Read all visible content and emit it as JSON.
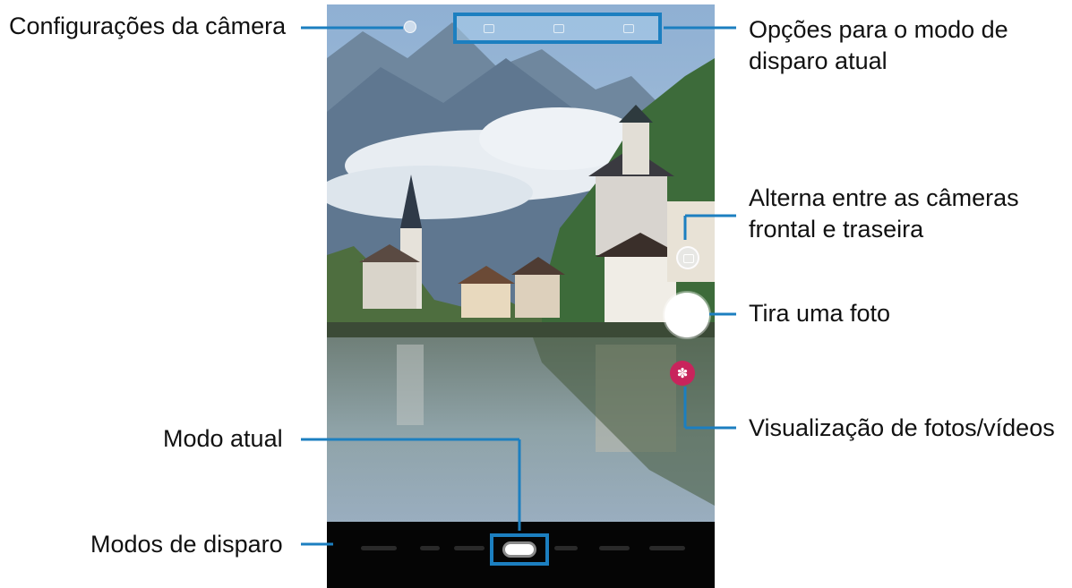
{
  "callouts": {
    "camera_settings": "Configurações da câmera",
    "shooting_options_line1": "Opções para o modo de",
    "shooting_options_line2": "disparo atual",
    "switch_cameras_line1": "Alterna entre as câmeras",
    "switch_cameras_line2": "frontal e traseira",
    "take_photo": "Tira uma foto",
    "preview": "Visualização de fotos/vídeos",
    "current_mode": "Modo atual",
    "shooting_modes": "Modos de disparo"
  },
  "icons": {
    "settings": "gear-icon",
    "top_options": [
      "flash-icon",
      "timer-icon",
      "ratio-icon"
    ],
    "switch_camera": "switch-camera-icon",
    "preview": "flower-icon"
  },
  "colors": {
    "callout_line": "#1c7fc0",
    "preview_thumb": "#c8245c",
    "mode_bar": "#050505"
  }
}
